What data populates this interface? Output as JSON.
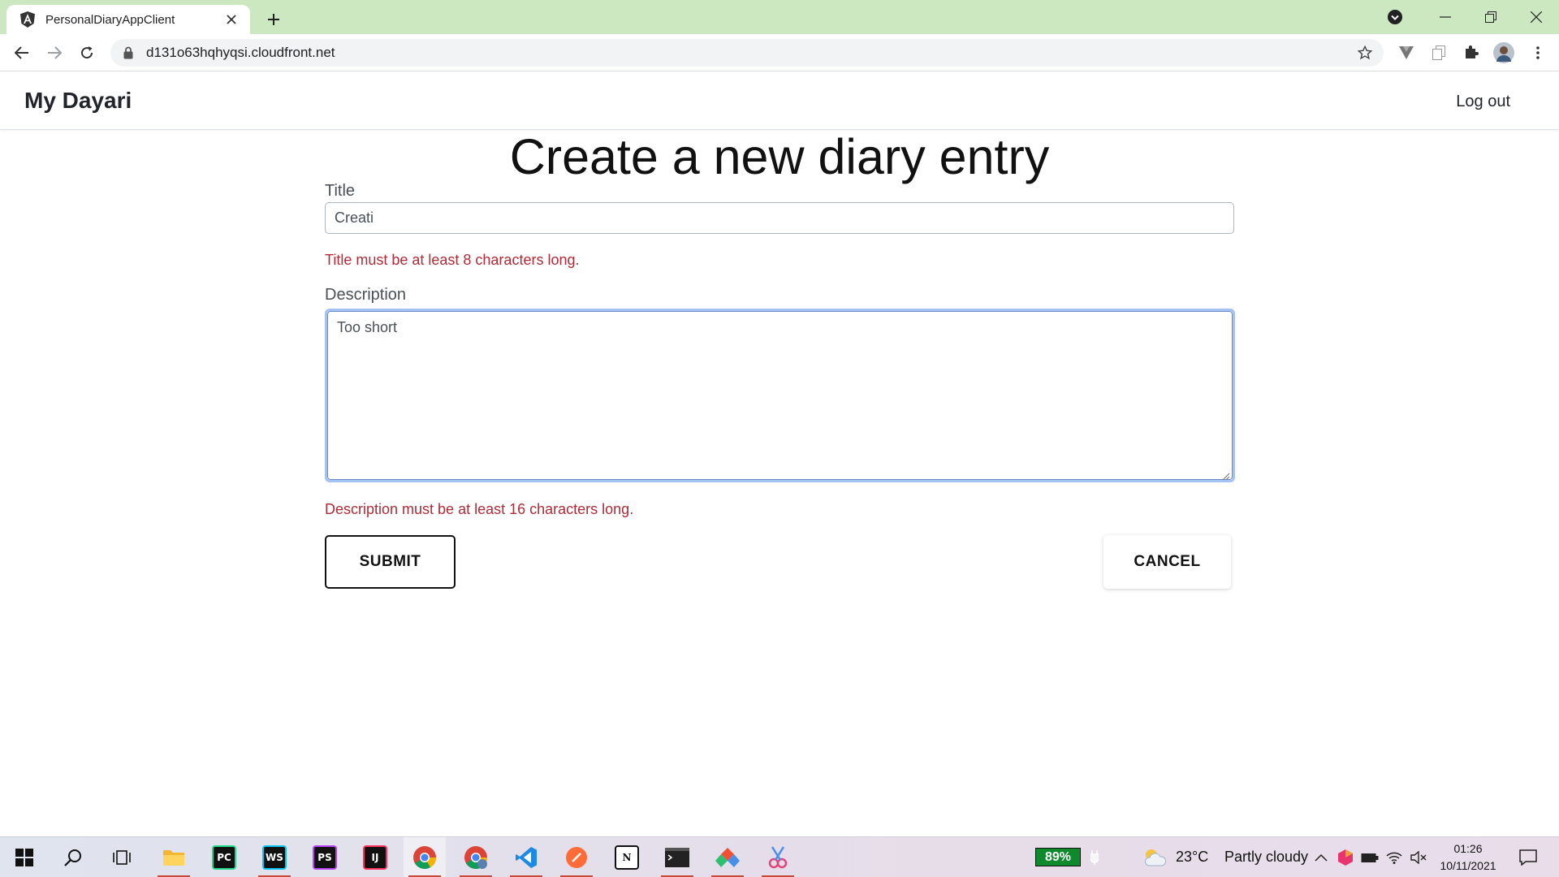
{
  "browser": {
    "tab_title": "PersonalDiaryAppClient",
    "url": "d131o63hqhyqsi.cloudfront.net"
  },
  "app": {
    "brand": "My Dayari",
    "logout_label": "Log out"
  },
  "form": {
    "heading": "Create a new diary entry",
    "title_label": "Title",
    "title_value": "Creati",
    "title_error": "Title must be at least 8 characters long.",
    "description_label": "Description",
    "description_value": "Too short",
    "description_error": "Description must be at least 16 characters long.",
    "submit_label": "SUBMIT",
    "cancel_label": "CANCEL"
  },
  "taskbar": {
    "battery": "89%",
    "weather_temp": "23°C",
    "weather_text": "Partly cloudy",
    "time": "01:26",
    "date": "10/11/2021",
    "apps": [
      "start-icon",
      "search-icon",
      "task-view-icon",
      "file-explorer-icon",
      "pycharm-icon",
      "webstorm-icon",
      "phpstorm-icon",
      "intellij-icon",
      "chrome-icon",
      "chrome-profile-icon",
      "vscode-icon",
      "postman-icon",
      "notion-icon",
      "terminal-icon",
      "sourcetree-icon",
      "snipping-tool-icon"
    ]
  },
  "colors": {
    "tabbar": "#cce8c0",
    "error": "#b02a37",
    "focus_ring": "#a4c2f4",
    "battery": "#0e8a2c"
  }
}
